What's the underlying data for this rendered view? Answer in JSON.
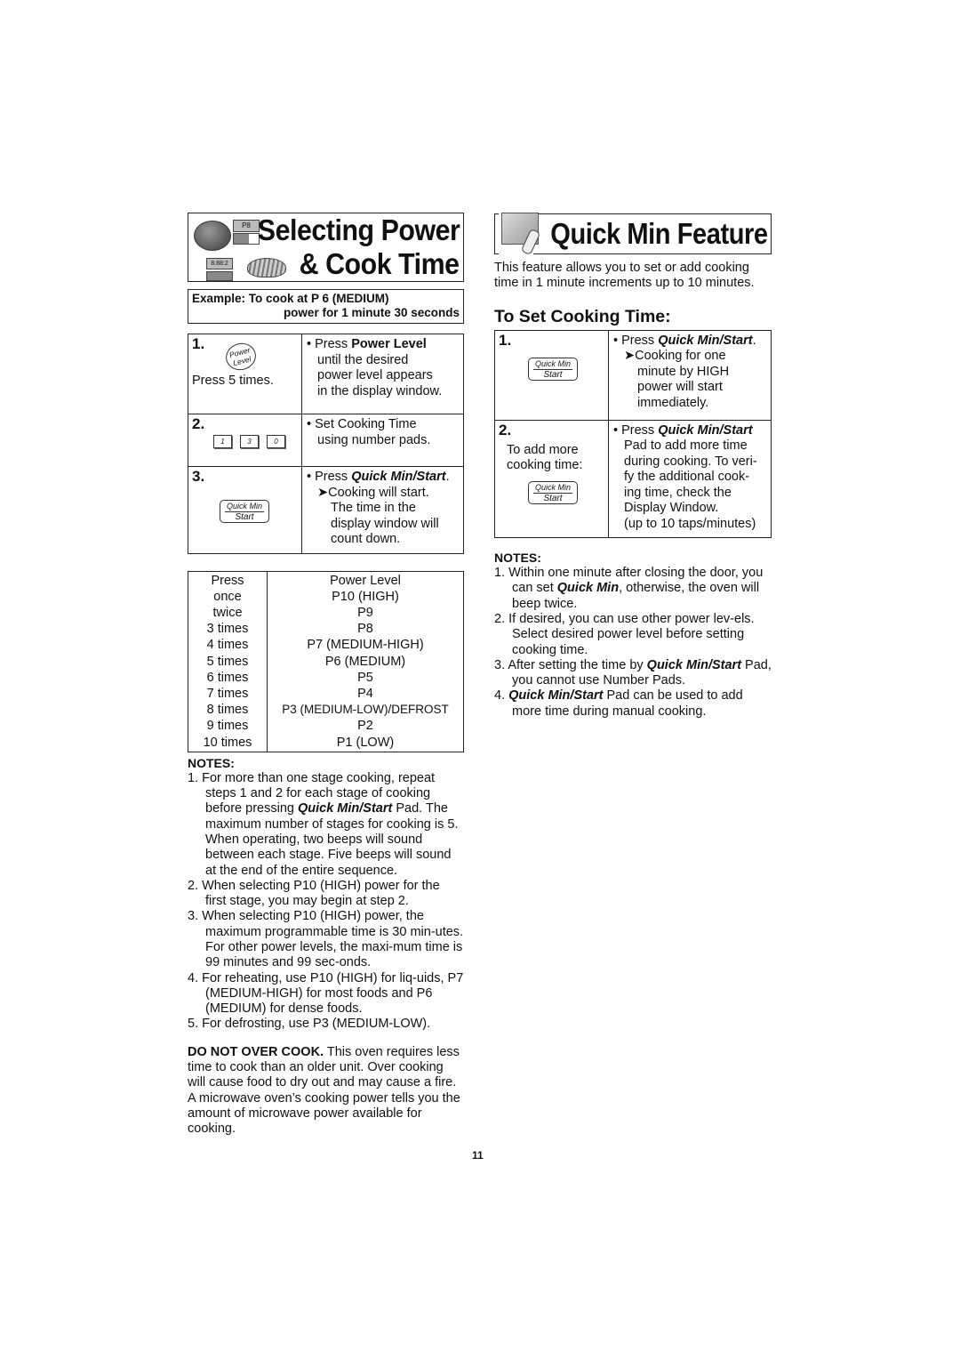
{
  "left": {
    "title_line1": "Selecting Power",
    "title_line2": "& Cook Time",
    "title_icons": [
      "tomato-icon",
      "display-icon",
      "power-bar-icon",
      "dish-icon"
    ],
    "display_text_1": "P8",
    "display_text_2": "8:88:2",
    "example_line1": "Example: To cook at P 6 (MEDIUM)",
    "example_line2": "power for 1 minute 30 seconds",
    "steps": [
      {
        "num": "1.",
        "pad_label_top": "Power",
        "pad_label_bottom": "Level",
        "caption": "Press 5 times.",
        "bullet_prefix": "• Press ",
        "bullet_bold": "Power Level",
        "lines": [
          "until the desired",
          "power level appears",
          "in the display window."
        ]
      },
      {
        "num": "2.",
        "number_pads": [
          "1",
          "3",
          "0"
        ],
        "bullet": "• Set Cooking Time",
        "lines": [
          "using number pads."
        ]
      },
      {
        "num": "3.",
        "pad_top": "Quick Min",
        "pad_bottom": "Start",
        "bullet_prefix": "• Press ",
        "bullet_bold": "Quick Min/Start",
        "bullet_suffix": ".",
        "arrow_line": "➤Cooking will start.",
        "lines": [
          "The time in the",
          "display window will",
          "count down."
        ]
      }
    ],
    "power_table": {
      "headers": [
        "Press",
        "Power Level"
      ],
      "rows": [
        [
          "once",
          "P10 (HIGH)"
        ],
        [
          "twice",
          "P9"
        ],
        [
          "3 times",
          "P8"
        ],
        [
          "4 times",
          "P7 (MEDIUM-HIGH)"
        ],
        [
          "5 times",
          "P6 (MEDIUM)"
        ],
        [
          "6 times",
          "P5"
        ],
        [
          "7 times",
          "P4"
        ],
        [
          "8 times",
          "P3 (MEDIUM-LOW)/DEFROST"
        ],
        [
          "9 times",
          "P2"
        ],
        [
          "10 times",
          "P1 (LOW)"
        ]
      ]
    },
    "notes_heading": "NOTES:",
    "notes": {
      "n1_a": "1. For more than one stage cooking, repeat steps 1 and 2 for each stage of cooking before pressing ",
      "n1_bold": "Quick Min/Start",
      "n1_b": " Pad. The maximum number of stages for cooking is 5. When operating, two beeps will sound between each stage. Five beeps will sound at the end of the entire sequence.",
      "n2": "2. When selecting P10 (HIGH) power for the first stage, you may begin at step 2.",
      "n3": "3. When selecting P10 (HIGH) power, the maximum programmable time is 30 min-utes. For other power levels, the maxi-mum time is 99 minutes and 99 sec-onds.",
      "n4": "4. For reheating, use P10 (HIGH) for liq-uids, P7 (MEDIUM-HIGH) for most foods and P6 (MEDIUM) for dense foods.",
      "n5": "5. For defrosting, use P3 (MEDIUM-LOW)."
    },
    "warning_bold": "DO NOT OVER COOK.",
    "warning_text": " This oven requires less time to cook than an older unit. Over cooking will cause food to dry out and may cause a fire. A microwave oven’s cooking power tells you the amount of microwave power available for cooking."
  },
  "right": {
    "title": "Quick Min Feature",
    "title_icon": "hand-pressing-pad-icon",
    "intro": "This feature allows you to set or add cooking time in 1 minute increments up to 10 minutes.",
    "subheading": "To Set Cooking Time:",
    "steps": [
      {
        "num": "1.",
        "pad_top": "Quick Min",
        "pad_bottom": "Start",
        "bullet_prefix": "• Press ",
        "bullet_bold": "Quick Min/Start",
        "bullet_suffix": ".",
        "arrow_line": "➤Cooking for one",
        "lines": [
          "minute by HIGH",
          "power will start",
          "immediately."
        ]
      },
      {
        "num": "2.",
        "caption_line1": "To add more",
        "caption_line2": "cooking time:",
        "pad_top": "Quick Min",
        "pad_bottom": "Start",
        "bullet_prefix": "• Press ",
        "bullet_bold": "Quick Min/Start",
        "lines": [
          "Pad to add more time",
          "during cooking. To veri-",
          "fy the additional cook-",
          "ing time, check the",
          "Display Window.",
          "(up to 10 taps/minutes)"
        ]
      }
    ],
    "notes_heading": "NOTES:",
    "notes": {
      "n1_a": "1. Within one minute after closing the door, you can set ",
      "n1_bold": "Quick Min",
      "n1_b": ", otherwise, the oven will beep twice.",
      "n2": "2. If desired, you can use other power lev-els. Select desired power level before setting cooking time.",
      "n3_a": "3. After setting the time by ",
      "n3_bold": "Quick Min/Start",
      "n3_b": " Pad, you cannot use Number Pads.",
      "n4_a": "4. ",
      "n4_bold": "Quick Min/Start",
      "n4_b": " Pad can be used to add more time during manual cooking."
    }
  },
  "page_number": "11"
}
